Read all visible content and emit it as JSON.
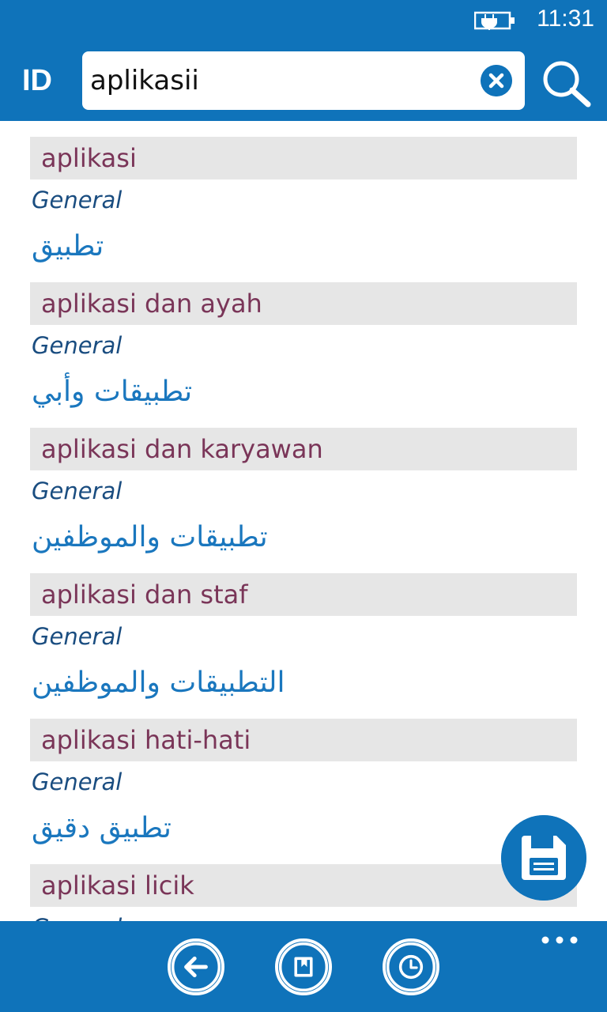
{
  "status": {
    "time": "11:31"
  },
  "header": {
    "lang": "ID"
  },
  "search": {
    "value": "aplikasii"
  },
  "results": [
    {
      "term": "aplikasi",
      "category": "General",
      "translation": "تطبيق"
    },
    {
      "term": "aplikasi dan ayah",
      "category": "General",
      "translation": "تطبيقات وأبي"
    },
    {
      "term": "aplikasi dan karyawan",
      "category": "General",
      "translation": "تطبيقات والموظفين"
    },
    {
      "term": "aplikasi dan staf",
      "category": "General",
      "translation": "التطبيقات والموظفين"
    },
    {
      "term": "aplikasi hati-hati",
      "category": "General",
      "translation": "تطبيق دقيق"
    },
    {
      "term": "aplikasi licik",
      "category": "General",
      "translation": ""
    }
  ],
  "colors": {
    "accent": "#0f73ba",
    "term": "#7a3558",
    "category": "#1a4d80",
    "translation": "#1a77be"
  }
}
